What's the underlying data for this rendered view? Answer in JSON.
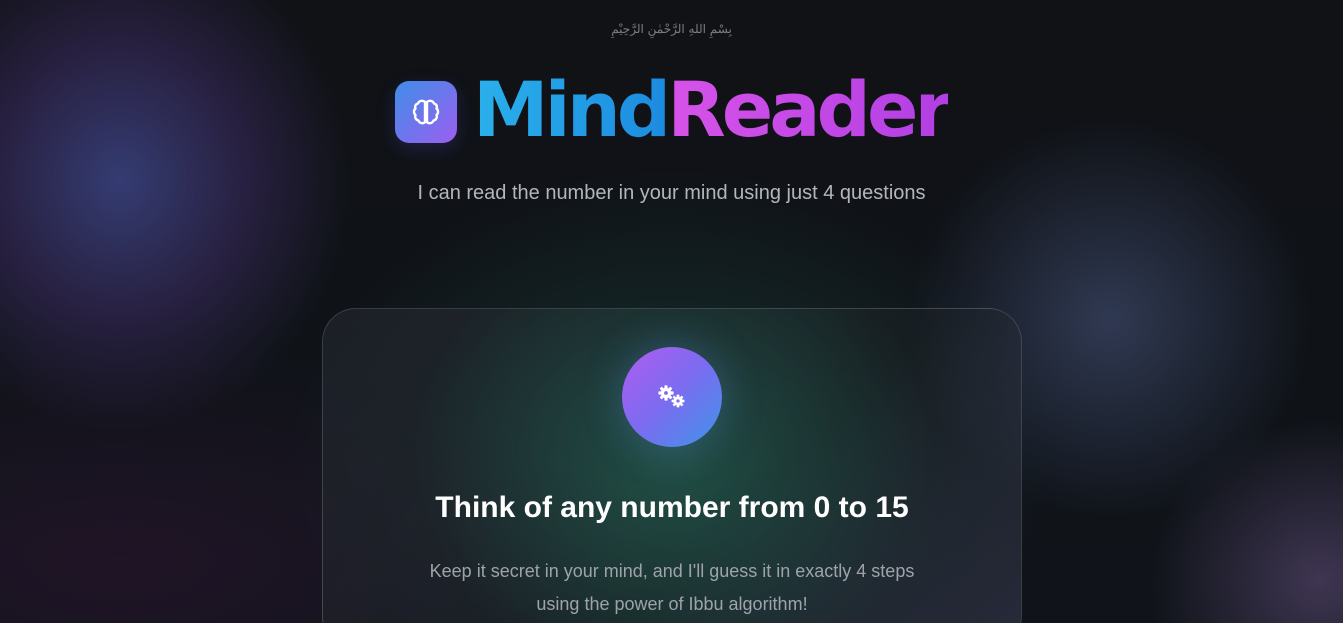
{
  "header": {
    "bismillah": "بِسْمِ اللهِ الرَّحْمٰنِ الرَّحِيْمِ",
    "brand_part1": "Mind",
    "brand_part2": "Reader",
    "tagline": "I can read the number in your mind using just 4 questions",
    "logo_icon": "brain-icon"
  },
  "card": {
    "icon": "gears-icon",
    "title": "Think of any number from 0 to 15",
    "description": "Keep it secret in your mind, and I'll guess it in exactly 4 steps using the power of Ibbu algorithm!"
  },
  "colors": {
    "mind": "#1ea0e6",
    "reader": "#c94ee6",
    "background": "#0e1116"
  }
}
